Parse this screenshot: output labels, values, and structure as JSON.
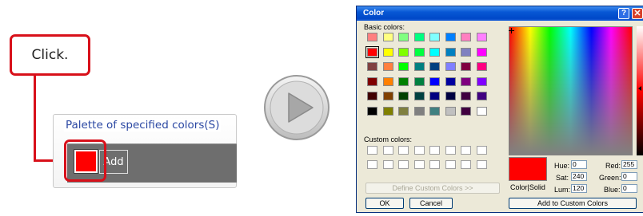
{
  "callout": {
    "text": "Click."
  },
  "palette": {
    "legend": "Palette of specified colors(S)",
    "add_label": "Add",
    "selected_color": "#ff0000"
  },
  "dialog": {
    "title": "Color",
    "help_glyph": "?",
    "close_glyph": "✕",
    "basic_colors_label": "Basic colors:",
    "custom_colors_label": "Custom colors:",
    "define_custom_label": "Define Custom Colors >>",
    "ok_label": "OK",
    "cancel_label": "Cancel",
    "color_solid_label": "Color|Solid",
    "add_custom_label": "Add to Custom Colors",
    "hue_label": "Hue:",
    "hue": "0",
    "sat_label": "Sat:",
    "sat": "240",
    "lum_label": "Lum:",
    "lum": "120",
    "red_label": "Red:",
    "red": "255",
    "green_label": "Green:",
    "green": "0",
    "blue_label": "Blue:",
    "blue": "0",
    "basic_colors": [
      "#ff8080",
      "#ffff80",
      "#80ff80",
      "#00ff80",
      "#80ffff",
      "#0080ff",
      "#ff80c0",
      "#ff80ff",
      "#ff0000",
      "#ffff00",
      "#80ff00",
      "#00ff40",
      "#00ffff",
      "#0080c0",
      "#8080c0",
      "#ff00ff",
      "#804040",
      "#ff8040",
      "#00ff00",
      "#008080",
      "#004080",
      "#8080ff",
      "#800040",
      "#ff0080",
      "#800000",
      "#ff8000",
      "#008000",
      "#008040",
      "#0000ff",
      "#0000a0",
      "#800080",
      "#8000ff",
      "#400000",
      "#804000",
      "#004000",
      "#004040",
      "#000080",
      "#000040",
      "#400040",
      "#400080",
      "#000000",
      "#808000",
      "#808040",
      "#808080",
      "#408080",
      "#c0c0c0",
      "#400040",
      "#ffffff"
    ],
    "selected_swatch_index": 8,
    "custom_count": 16
  }
}
